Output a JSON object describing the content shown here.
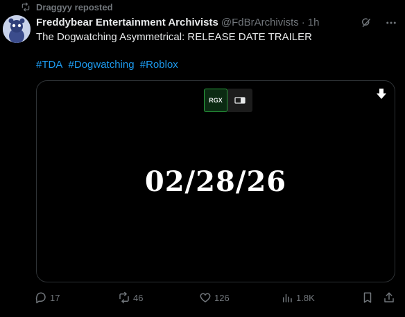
{
  "repost": {
    "label": "Draggyy reposted"
  },
  "author": {
    "name": "Freddybear Entertainment Archivists",
    "handle": "@FdBrArchivists",
    "separator": "·",
    "time": "1h"
  },
  "tweet": {
    "text": "The Dogwatching Asymmetrical: RELEASE DATE TRAILER",
    "hashtags": [
      "#TDA",
      "#Dogwatching",
      "#Roblox"
    ]
  },
  "media": {
    "badge_label": "RGX",
    "release_date": "02/28/26"
  },
  "actions": {
    "replies": "17",
    "reposts": "46",
    "likes": "126",
    "views": "1.8K"
  },
  "colors": {
    "background": "#000000",
    "text": "#e7e9ea",
    "secondary": "#71767b",
    "link": "#1d9bf0",
    "border": "#2f3336",
    "badge_green": "#2aa43f"
  },
  "icons": [
    "repost-icon",
    "grok-icon",
    "more-icon",
    "download-icon",
    "reply-icon",
    "views-icon",
    "bookmark-icon",
    "share-icon",
    "like-icon"
  ]
}
